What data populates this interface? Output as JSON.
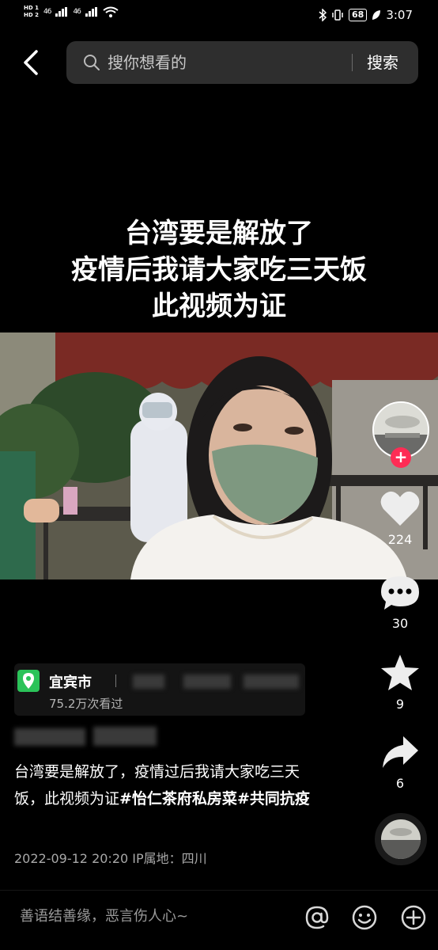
{
  "status_bar": {
    "hd1": "HD 1",
    "hd2": "HD 2",
    "network1": "46",
    "network2": "46",
    "battery": "68",
    "time": "3:07"
  },
  "header": {
    "search_placeholder": "搜你想看的",
    "search_button": "搜索"
  },
  "video": {
    "overlay_title_lines": [
      "台湾要是解放了",
      "疫情后我请大家吃三天饭",
      "此视频为证"
    ]
  },
  "actions": {
    "likes": "224",
    "comments": "30",
    "favorites": "9",
    "shares": "6"
  },
  "location": {
    "name": "宜宾市",
    "views": "75.2万次看过"
  },
  "post": {
    "description_text": "台湾要是解放了，疫情过后我请大家吃三天饭，此视频为证",
    "tag1": "#怡仁茶府私房菜",
    "tag2": "#共同抗疫",
    "date": "2022-09-12 20:20",
    "ip_location": "IP属地：四川"
  },
  "comment_bar": {
    "placeholder": "善语结善缘，恶言伤人心~"
  },
  "colors": {
    "background": "#000000",
    "search_box": "#2e2e2e",
    "follow_accent": "#fe2c55",
    "location_icon": "#2bc359"
  }
}
